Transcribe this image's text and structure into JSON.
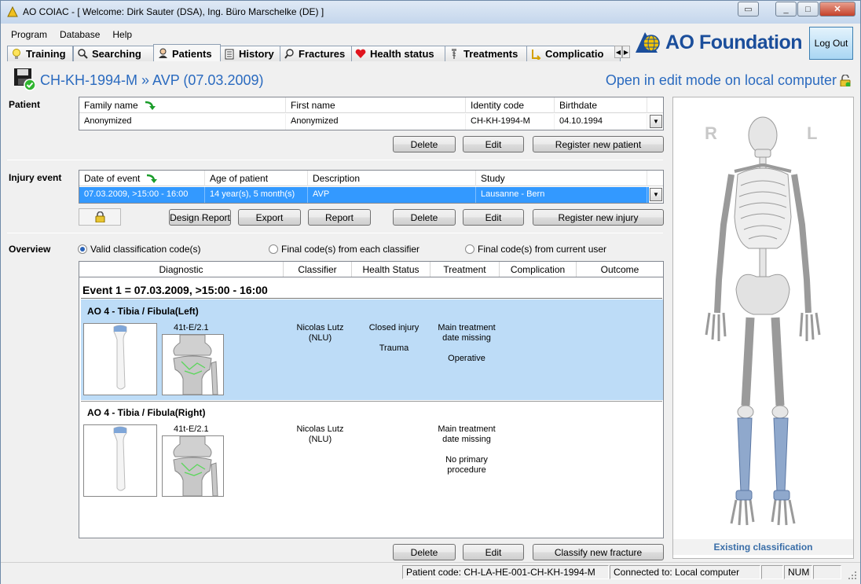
{
  "window": {
    "title": "AO COIAC - [ Welcome: Dirk Sauter (DSA), Ing. Büro Marschelke (DE) ]"
  },
  "menu": [
    "Program",
    "Database",
    "Help"
  ],
  "tabs": [
    {
      "label": "Training",
      "icon": "lightbulb-icon"
    },
    {
      "label": "Searching",
      "icon": "search-icon"
    },
    {
      "label": "Patients",
      "icon": "patient-icon",
      "active": true
    },
    {
      "label": "History",
      "icon": "history-icon"
    },
    {
      "label": "Fractures",
      "icon": "fracture-search-icon"
    },
    {
      "label": "Health status",
      "icon": "heart-icon"
    },
    {
      "label": "Treatments",
      "icon": "screw-icon"
    },
    {
      "label": "Complicatio",
      "icon": "complication-icon"
    }
  ],
  "brand": {
    "name": "AO Foundation",
    "logout": "Log Out"
  },
  "header": {
    "case_title": "CH-KH-1994-M » AVP (07.03.2009)",
    "mode": "Open in edit mode on local computer"
  },
  "patient": {
    "label": "Patient",
    "columns": [
      "Family name",
      "First name",
      "Identity code",
      "Birthdate"
    ],
    "row": [
      "Anonymized",
      "Anonymized",
      "CH-KH-1994-M",
      "04.10.1994"
    ],
    "buttons": {
      "delete": "Delete",
      "edit": "Edit",
      "register": "Register new patient"
    }
  },
  "injury": {
    "label": "Injury event",
    "columns": [
      "Date of event",
      "Age of patient",
      "Description",
      "Study"
    ],
    "row": [
      "07.03.2009, >15:00 - 16:00",
      "14 year(s), 5 month(s)",
      "AVP",
      "Lausanne - Bern"
    ],
    "buttons": {
      "design_report": "Design Report",
      "export": "Export",
      "report": "Report",
      "delete": "Delete",
      "edit": "Edit",
      "register": "Register new injury"
    }
  },
  "overview": {
    "label": "Overview",
    "radios": [
      "Valid classification code(s)",
      "Final code(s) from each classifier",
      "Final code(s) from current user"
    ],
    "columns": [
      "Diagnostic",
      "Classifier",
      "Health Status",
      "Treatment",
      "Complication",
      "Outcome"
    ],
    "event_title": "Event 1 = 07.03.2009, >15:00 - 16:00",
    "fractures": [
      {
        "name": "AO 4 - Tibia / Fibula(Left)",
        "code": "41t-E/2.1",
        "classifier": "Nicolas Lutz",
        "classifier_short": "(NLU)",
        "health_1": "Closed injury",
        "health_2": "Trauma",
        "treatment_1": "Main treatment",
        "treatment_2": "date missing",
        "treatment_3": "Operative",
        "treatment_4": ""
      },
      {
        "name": "AO 4 - Tibia / Fibula(Right)",
        "code": "41t-E/2.1",
        "classifier": "Nicolas Lutz",
        "classifier_short": "(NLU)",
        "health_1": "",
        "health_2": "",
        "treatment_1": "Main treatment",
        "treatment_2": "date missing",
        "treatment_3": "No primary",
        "treatment_4": "procedure"
      }
    ],
    "buttons": {
      "delete": "Delete",
      "edit": "Edit",
      "classify": "Classify new fracture"
    }
  },
  "skeleton": {
    "right": "R",
    "left": "L",
    "caption": "Existing classification"
  },
  "status": {
    "patient_code": "Patient code: CH-LA-HE-001-CH-KH-1994-M",
    "connection": "Connected to: Local computer",
    "num": "NUM"
  },
  "colors": {
    "accent_blue": "#2a6abf",
    "selection": "#3399ff",
    "highlight_row": "#bddcf7",
    "brand_blue": "#1b4e9b"
  }
}
